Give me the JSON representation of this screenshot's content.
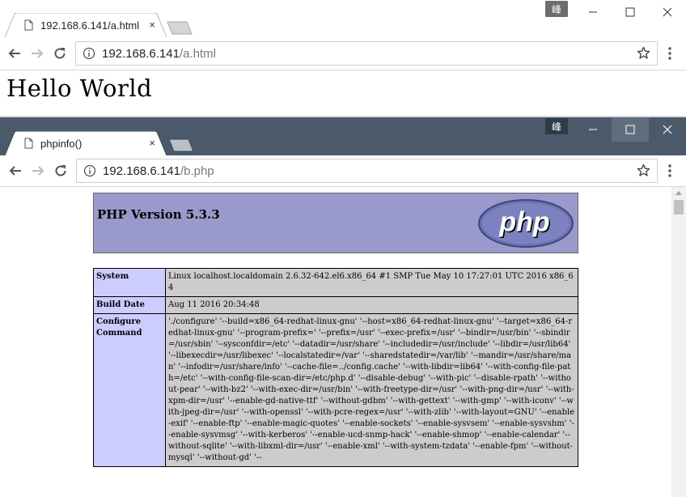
{
  "window_back": {
    "tab_title": "192.168.6.141/a.html",
    "tab_close": "×",
    "badge": "峰",
    "address": {
      "host": "192.168.6.141",
      "path": "/a.html"
    },
    "page_text": "Hello World"
  },
  "window_front": {
    "tab_title": "phpinfo()",
    "tab_close": "×",
    "badge": "峰",
    "address": {
      "host": "192.168.6.141",
      "path": "/b.php"
    },
    "php_header": {
      "title": "PHP Version 5.3.3",
      "logo_text": "php"
    },
    "info_rows": [
      {
        "label": "System",
        "value": "Linux localhost.localdomain 2.6.32-642.el6.x86_64 #1 SMP Tue May 10 17:27:01 UTC 2016 x86_64"
      },
      {
        "label": "Build Date",
        "value": "Aug 11 2016 20:34:48"
      },
      {
        "label": "Configure Command",
        "value": "'./configure' '--build=x86_64-redhat-linux-gnu' '--host=x86_64-redhat-linux-gnu' '--target=x86_64-redhat-linux-gnu' '--program-prefix=' '--prefix=/usr' '--exec-prefix=/usr' '--bindir=/usr/bin' '--sbindir=/usr/sbin' '--sysconfdir=/etc' '--datadir=/usr/share' '--includedir=/usr/include' '--libdir=/usr/lib64' '--libexecdir=/usr/libexec' '--localstatedir=/var' '--sharedstatedir=/var/lib' '--mandir=/usr/share/man' '--infodir=/usr/share/info' '--cache-file=../config.cache' '--with-libdir=lib64' '--with-config-file-path=/etc' '--with-config-file-scan-dir=/etc/php.d' '--disable-debug' '--with-pic' '--disable-rpath' '--without-pear' '--with-bz2' '--with-exec-dir=/usr/bin' '--with-freetype-dir=/usr' '--with-png-dir=/usr' '--with-xpm-dir=/usr' '--enable-gd-native-ttf' '--without-gdbm' '--with-gettext' '--with-gmp' '--with-iconv' '--with-jpeg-dir=/usr' '--with-openssl' '--with-pcre-regex=/usr' '--with-zlib' '--with-layout=GNU' '--enable-exif' '--enable-ftp' '--enable-magic-quotes' '--enable-sockets' '--enable-sysvsem' '--enable-sysvshm' '--enable-sysvmsg' '--with-kerberos' '--enable-ucd-snmp-hack' '--enable-shmop' '--enable-calendar' '--without-sqlite' '--with-libxml-dir=/usr' '--enable-xml' '--with-system-tzdata' '--enable-fpm' '--without-mysql' '--without-gd' '--"
      }
    ]
  },
  "colors": {
    "front_titlebar": "#4a5a6b",
    "php_header_bg": "#9999cc",
    "info_label_bg": "#ccccff",
    "info_value_bg": "#cccccc"
  }
}
